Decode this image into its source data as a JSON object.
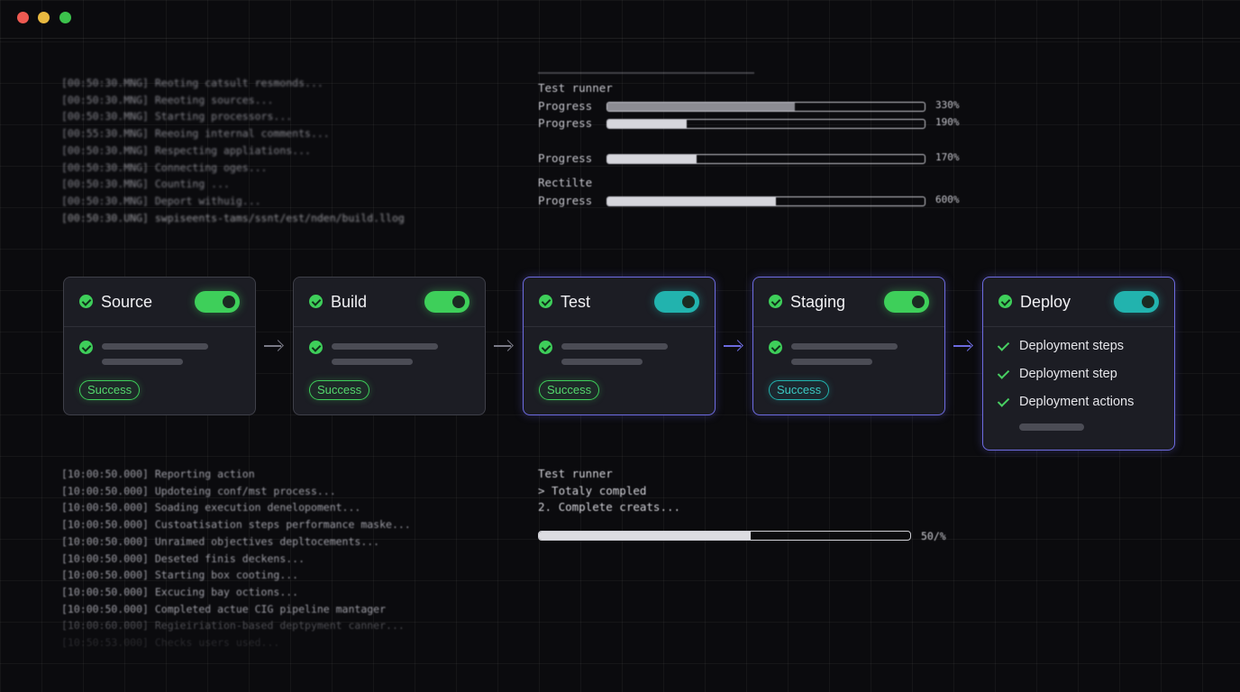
{
  "window": {
    "controls": [
      "close",
      "minimize",
      "maximize"
    ]
  },
  "top_log": [
    "[00:50:30.MNG] Reoting catsult resmonds...",
    "[00:50:30.MNG] Reeoting sources...",
    "[00:50:30.MNG] Starting processors...",
    "[00:55:30.MNG] Reeoing internal comments...",
    "[00:50:30.MNG] Respecting appliations...",
    "[00:50:30.MNG] Connecting oges...",
    "[00:50:30.MNG] Counting ...",
    "[00:50:30.MNG] Deport withuig...",
    "[00:50:30.UNG] swpiseents-tams/ssnt/est/nden/build.llog"
  ],
  "test_runner_top": {
    "title": "Test runner",
    "rows": [
      {
        "label": "Progress",
        "pct_text": "330%",
        "fill": 0.59
      },
      {
        "label": "Progress",
        "pct_text": "190%",
        "fill": 0.25
      },
      {
        "label": "Progress",
        "pct_text": "170%",
        "fill": 0.28
      },
      {
        "label": "Progress",
        "pct_text": "600%",
        "fill": 0.53
      }
    ],
    "section_label": "Rectilte"
  },
  "pipeline": {
    "stages": [
      {
        "name": "Source",
        "toggle": "green",
        "status": "Success",
        "status_color": "green"
      },
      {
        "name": "Build",
        "toggle": "green",
        "status": "Success",
        "status_color": "green"
      },
      {
        "name": "Test",
        "toggle": "teal",
        "status": "Success",
        "status_color": "green"
      },
      {
        "name": "Staging",
        "toggle": "green",
        "status": "Success",
        "status_color": "teal"
      },
      {
        "name": "Deploy",
        "toggle": "teal",
        "steps": [
          "Deployment steps",
          "Deployment step",
          "Deployment actions"
        ]
      }
    ]
  },
  "bottom_log": [
    "[10:00:50.000] Reporting action",
    "[10:00:50.000] Updoteing conf/mst process...",
    "[10:00:50.000] Soading execution denelopoment...",
    "[10:00:50.000] Custoatisation steps performance maske...",
    "[10:00:50.000] Unraimed objectives depltocements...",
    "[10:00:50.000] Deseted finis deckens...",
    "[10:00:50.000] Starting box cooting...",
    "[10:00:50.000] Excucing bay octions...",
    "[10:00:50.000] Completed actue CIG pipeline mantager",
    "[10:00:60.000] Regieiriation-based deptpyment canner...",
    "[10:50:53.000] Checks users used..."
  ],
  "test_runner_bottom": {
    "lines": [
      "Test runner",
      "> Totaly compled",
      "2. Complete creats..."
    ],
    "progress_text": "50/%",
    "progress_fill": 0.57
  },
  "colors": {
    "success": "#3ecf5a",
    "teal": "#22b3ae",
    "active_border": "#6d6be0"
  }
}
